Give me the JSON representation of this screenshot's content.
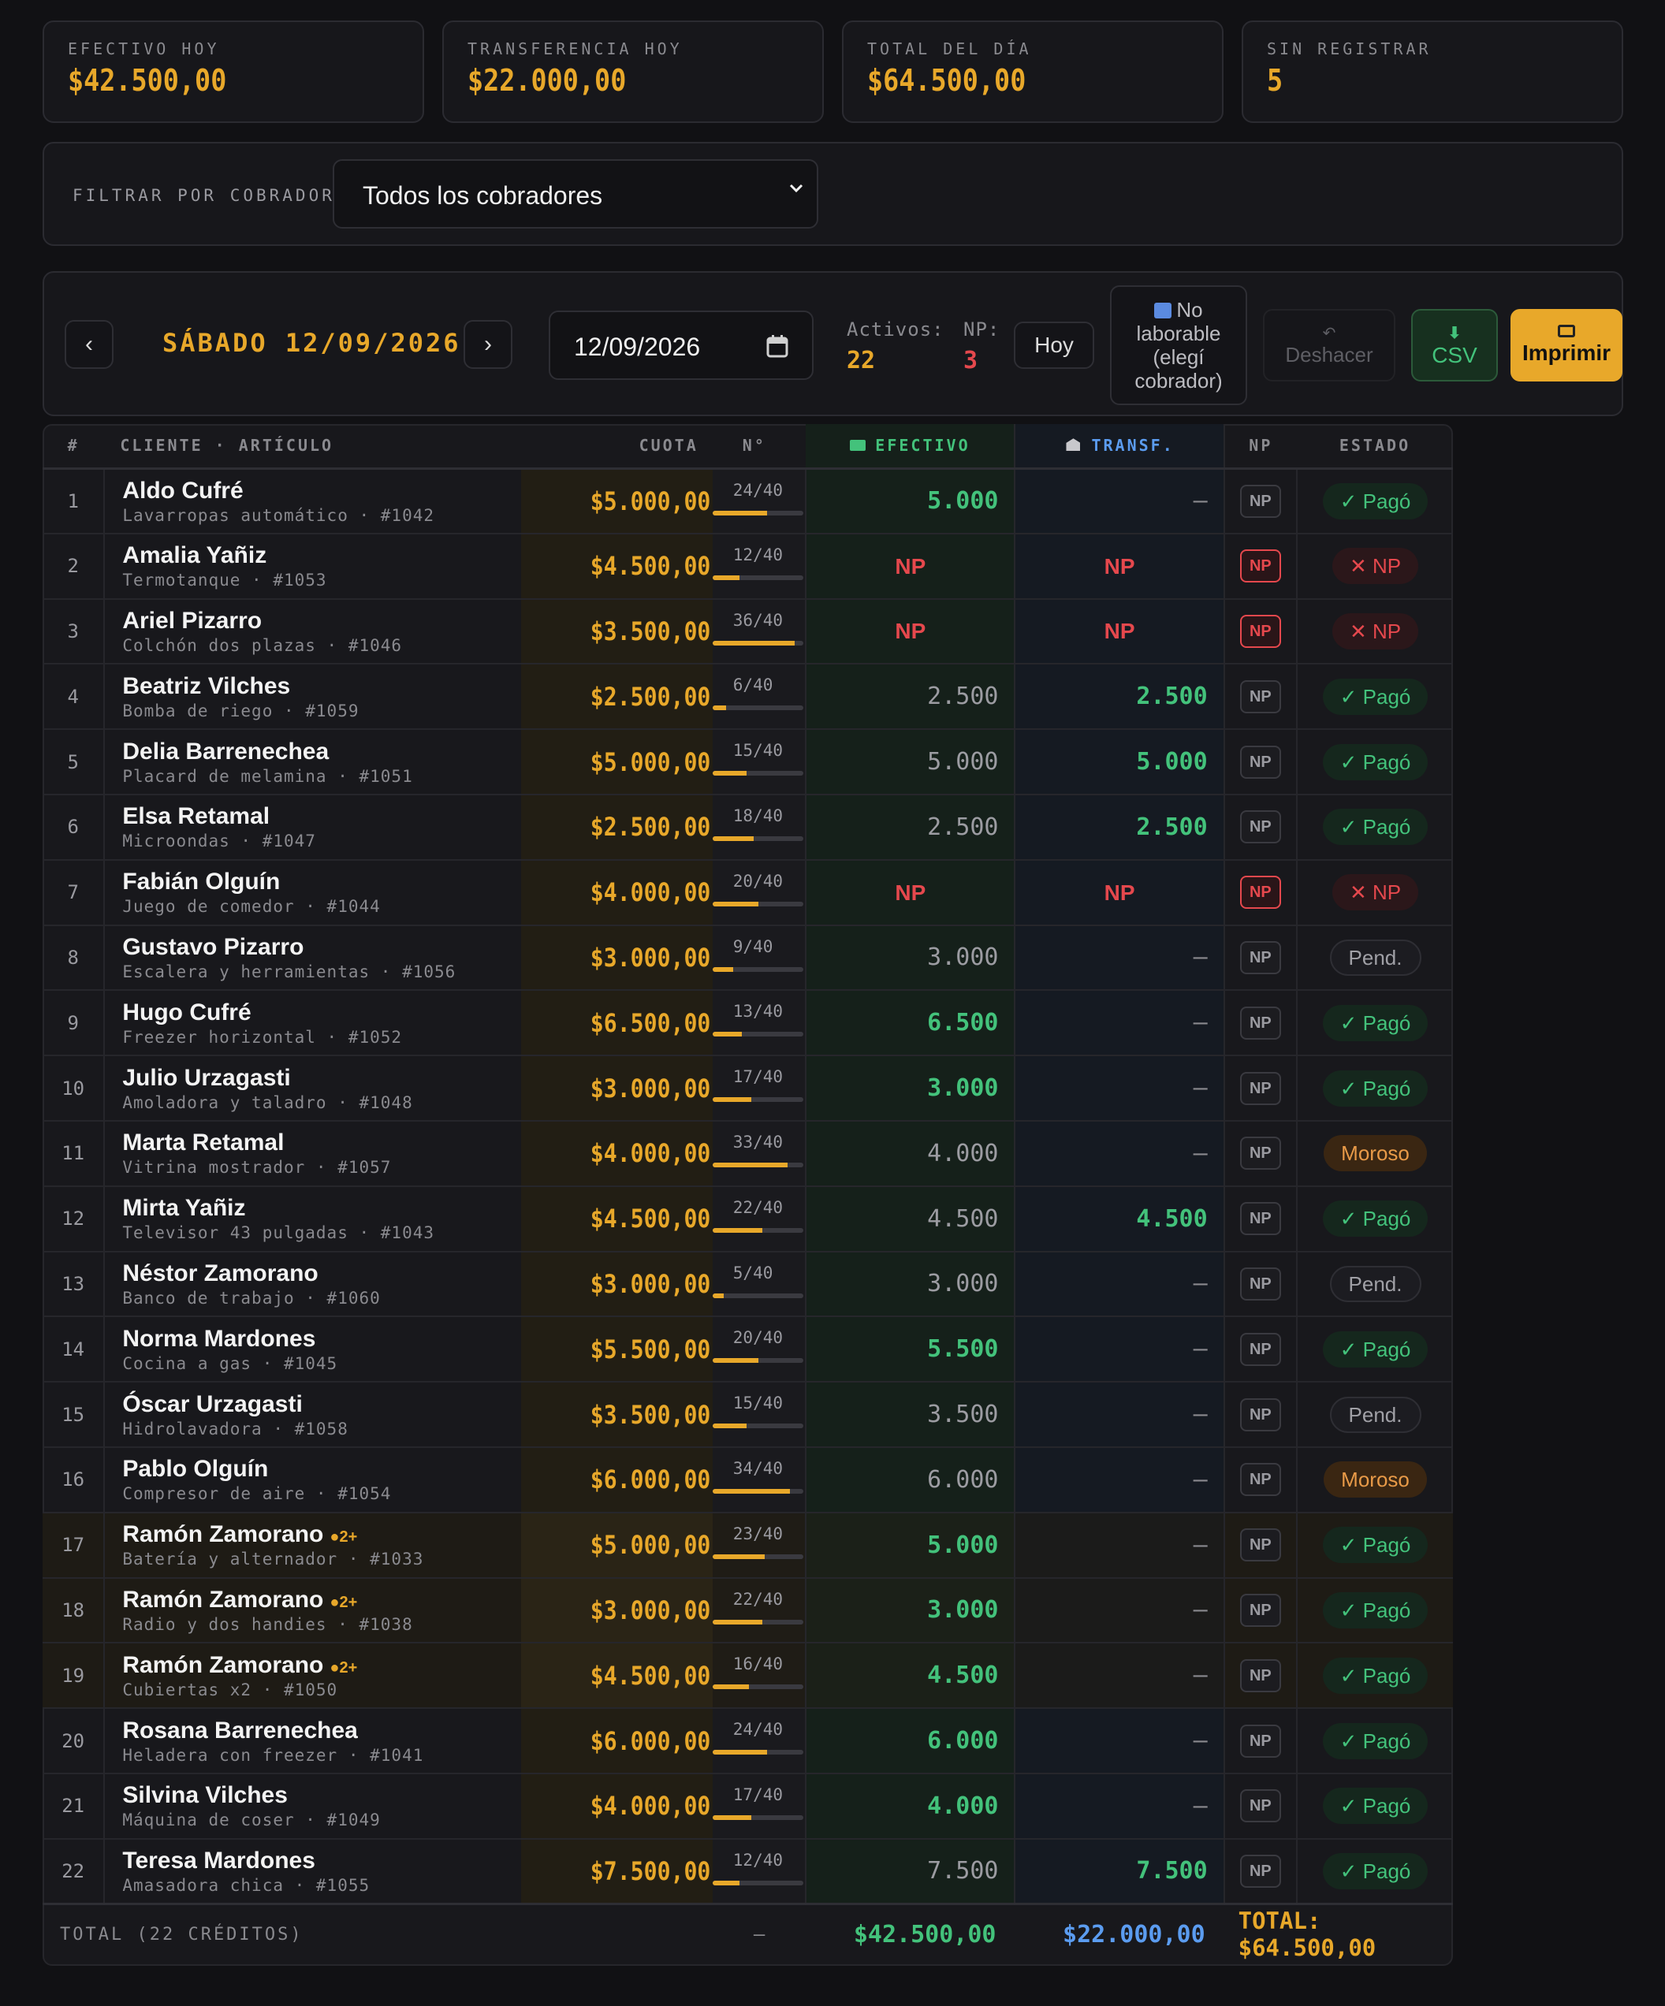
{
  "stats": [
    {
      "label": "EFECTIVO HOY",
      "value": "$42.500,00"
    },
    {
      "label": "TRANSFERENCIA HOY",
      "value": "$22.000,00"
    },
    {
      "label": "TOTAL DEL DÍA",
      "value": "$64.500,00"
    },
    {
      "label": "SIN REGISTRAR",
      "value": "5"
    }
  ],
  "filter": {
    "label": "FILTRAR POR COBRADOR",
    "selected": "Todos los cobradores"
  },
  "toolbar": {
    "prev": "‹",
    "next": "›",
    "day_label": "SÁBADO 12/09/2026",
    "date_value": "12/09/2026",
    "activos_label": "Activos:",
    "activos_value": "22",
    "np_label": "NP:",
    "np_value": "3",
    "hoy_label": "Hoy",
    "nolab_line1": "No",
    "nolab_line2": "laborable",
    "nolab_line3": "(elegí",
    "nolab_line4": "cobrador)",
    "deshacer_label": "Deshacer",
    "csv_label": "CSV",
    "imprimir_label": "Imprimir"
  },
  "table": {
    "headers": {
      "idx": "#",
      "cliente": "CLIENTE · ARTÍCULO",
      "cuota": "CUOTA",
      "n": "N°",
      "efectivo": "EFECTIVO",
      "transf": "TRANSF.",
      "np": "NP",
      "estado": "ESTADO"
    },
    "rows": [
      {
        "i": "1",
        "name": "Aldo Cufré",
        "sub": "Lavarropas automático · #1042",
        "cuota": "$5.000,00",
        "n": "24/40",
        "prog": 0.6,
        "ef": "5.000",
        "efc": "green",
        "tr": "—",
        "trc": "dash",
        "np": false,
        "st": "✓ Pagó",
        "stc": "pago",
        "dup": false
      },
      {
        "i": "2",
        "name": "Amalia Yañiz",
        "sub": "Termotanque · #1053",
        "cuota": "$4.500,00",
        "n": "12/40",
        "prog": 0.3,
        "ef": "NP",
        "efc": "np",
        "tr": "NP",
        "trc": "np",
        "np": true,
        "st": "✕ NP",
        "stc": "np",
        "dup": false
      },
      {
        "i": "3",
        "name": "Ariel Pizarro",
        "sub": "Colchón dos plazas · #1046",
        "cuota": "$3.500,00",
        "n": "36/40",
        "prog": 0.9,
        "ef": "NP",
        "efc": "np",
        "tr": "NP",
        "trc": "np",
        "np": true,
        "st": "✕ NP",
        "stc": "np",
        "dup": false
      },
      {
        "i": "4",
        "name": "Beatriz Vilches",
        "sub": "Bomba de riego · #1059",
        "cuota": "$2.500,00",
        "n": "6/40",
        "prog": 0.15,
        "ef": "2.500",
        "efc": "grey",
        "tr": "2.500",
        "trc": "green",
        "np": false,
        "st": "✓ Pagó",
        "stc": "pago",
        "dup": false
      },
      {
        "i": "5",
        "name": "Delia Barrenechea",
        "sub": "Placard de melamina · #1051",
        "cuota": "$5.000,00",
        "n": "15/40",
        "prog": 0.375,
        "ef": "5.000",
        "efc": "grey",
        "tr": "5.000",
        "trc": "green",
        "np": false,
        "st": "✓ Pagó",
        "stc": "pago",
        "dup": false
      },
      {
        "i": "6",
        "name": "Elsa Retamal",
        "sub": "Microondas · #1047",
        "cuota": "$2.500,00",
        "n": "18/40",
        "prog": 0.45,
        "ef": "2.500",
        "efc": "grey",
        "tr": "2.500",
        "trc": "green",
        "np": false,
        "st": "✓ Pagó",
        "stc": "pago",
        "dup": false
      },
      {
        "i": "7",
        "name": "Fabián Olguín",
        "sub": "Juego de comedor · #1044",
        "cuota": "$4.000,00",
        "n": "20/40",
        "prog": 0.5,
        "ef": "NP",
        "efc": "np",
        "tr": "NP",
        "trc": "np",
        "np": true,
        "st": "✕ NP",
        "stc": "np",
        "dup": false
      },
      {
        "i": "8",
        "name": "Gustavo Pizarro",
        "sub": "Escalera y herramientas · #1056",
        "cuota": "$3.000,00",
        "n": "9/40",
        "prog": 0.225,
        "ef": "3.000",
        "efc": "grey",
        "tr": "—",
        "trc": "dash",
        "np": false,
        "st": "Pend.",
        "stc": "pend",
        "dup": false
      },
      {
        "i": "9",
        "name": "Hugo Cufré",
        "sub": "Freezer horizontal · #1052",
        "cuota": "$6.500,00",
        "n": "13/40",
        "prog": 0.325,
        "ef": "6.500",
        "efc": "green",
        "tr": "—",
        "trc": "dash",
        "np": false,
        "st": "✓ Pagó",
        "stc": "pago",
        "dup": false
      },
      {
        "i": "10",
        "name": "Julio Urzagasti",
        "sub": "Amoladora y taladro · #1048",
        "cuota": "$3.000,00",
        "n": "17/40",
        "prog": 0.425,
        "ef": "3.000",
        "efc": "green",
        "tr": "—",
        "trc": "dash",
        "np": false,
        "st": "✓ Pagó",
        "stc": "pago",
        "dup": false
      },
      {
        "i": "11",
        "name": "Marta Retamal",
        "sub": "Vitrina mostrador · #1057",
        "cuota": "$4.000,00",
        "n": "33/40",
        "prog": 0.825,
        "ef": "4.000",
        "efc": "grey",
        "tr": "—",
        "trc": "dash",
        "np": false,
        "st": "Moroso",
        "stc": "moroso",
        "dup": false
      },
      {
        "i": "12",
        "name": "Mirta Yañiz",
        "sub": "Televisor 43 pulgadas · #1043",
        "cuota": "$4.500,00",
        "n": "22/40",
        "prog": 0.55,
        "ef": "4.500",
        "efc": "grey",
        "tr": "4.500",
        "trc": "green",
        "np": false,
        "st": "✓ Pagó",
        "stc": "pago",
        "dup": false
      },
      {
        "i": "13",
        "name": "Néstor Zamorano",
        "sub": "Banco de trabajo · #1060",
        "cuota": "$3.000,00",
        "n": "5/40",
        "prog": 0.125,
        "ef": "3.000",
        "efc": "grey",
        "tr": "—",
        "trc": "dash",
        "np": false,
        "st": "Pend.",
        "stc": "pend",
        "dup": false
      },
      {
        "i": "14",
        "name": "Norma Mardones",
        "sub": "Cocina a gas · #1045",
        "cuota": "$5.500,00",
        "n": "20/40",
        "prog": 0.5,
        "ef": "5.500",
        "efc": "green",
        "tr": "—",
        "trc": "dash",
        "np": false,
        "st": "✓ Pagó",
        "stc": "pago",
        "dup": false
      },
      {
        "i": "15",
        "name": "Óscar Urzagasti",
        "sub": "Hidrolavadora · #1058",
        "cuota": "$3.500,00",
        "n": "15/40",
        "prog": 0.375,
        "ef": "3.500",
        "efc": "grey",
        "tr": "—",
        "trc": "dash",
        "np": false,
        "st": "Pend.",
        "stc": "pend",
        "dup": false
      },
      {
        "i": "16",
        "name": "Pablo Olguín",
        "sub": "Compresor de aire · #1054",
        "cuota": "$6.000,00",
        "n": "34/40",
        "prog": 0.85,
        "ef": "6.000",
        "efc": "grey",
        "tr": "—",
        "trc": "dash",
        "np": false,
        "st": "Moroso",
        "stc": "moroso",
        "dup": false
      },
      {
        "i": "17",
        "name": "Ramón Zamorano",
        "badge": "●2+",
        "sub": "Batería y alternador · #1033",
        "cuota": "$5.000,00",
        "n": "23/40",
        "prog": 0.575,
        "ef": "5.000",
        "efc": "green",
        "tr": "—",
        "trc": "dash",
        "np": false,
        "st": "✓ Pagó",
        "stc": "pago",
        "dup": true
      },
      {
        "i": "18",
        "name": "Ramón Zamorano",
        "badge": "●2+",
        "sub": "Radio y dos handies · #1038",
        "cuota": "$3.000,00",
        "n": "22/40",
        "prog": 0.55,
        "ef": "3.000",
        "efc": "green",
        "tr": "—",
        "trc": "dash",
        "np": false,
        "st": "✓ Pagó",
        "stc": "pago",
        "dup": true
      },
      {
        "i": "19",
        "name": "Ramón Zamorano",
        "badge": "●2+",
        "sub": "Cubiertas x2 · #1050",
        "cuota": "$4.500,00",
        "n": "16/40",
        "prog": 0.4,
        "ef": "4.500",
        "efc": "green",
        "tr": "—",
        "trc": "dash",
        "np": false,
        "st": "✓ Pagó",
        "stc": "pago",
        "dup": true
      },
      {
        "i": "20",
        "name": "Rosana Barrenechea",
        "sub": "Heladera con freezer · #1041",
        "cuota": "$6.000,00",
        "n": "24/40",
        "prog": 0.6,
        "ef": "6.000",
        "efc": "green",
        "tr": "—",
        "trc": "dash",
        "np": false,
        "st": "✓ Pagó",
        "stc": "pago",
        "dup": false
      },
      {
        "i": "21",
        "name": "Silvina Vilches",
        "sub": "Máquina de coser · #1049",
        "cuota": "$4.000,00",
        "n": "17/40",
        "prog": 0.425,
        "ef": "4.000",
        "efc": "green",
        "tr": "—",
        "trc": "dash",
        "np": false,
        "st": "✓ Pagó",
        "stc": "pago",
        "dup": false
      },
      {
        "i": "22",
        "name": "Teresa Mardones",
        "sub": "Amasadora chica · #1055",
        "cuota": "$7.500,00",
        "n": "12/40",
        "prog": 0.3,
        "ef": "7.500",
        "efc": "grey",
        "tr": "7.500",
        "trc": "green",
        "np": false,
        "st": "✓ Pagó",
        "stc": "pago",
        "dup": false
      }
    ],
    "np_button_label": "NP",
    "footer": {
      "label": "TOTAL (22 CRÉDITOS)",
      "n": "—",
      "efectivo": "$42.500,00",
      "transf": "$22.000,00",
      "total": "TOTAL: $64.500,00"
    }
  },
  "icons": {
    "select": "chevron-down-icon",
    "date": "calendar-icon",
    "efectivo": "cash-icon",
    "transf": "bank-icon",
    "nolab": "calendar-icon",
    "deshacer": "undo-icon",
    "csv": "download-icon",
    "imprimir": "printer-icon"
  },
  "colors": {
    "accent": "#e8a82a",
    "green": "#43c27b",
    "red": "#e5484d",
    "blue": "#5b9cf0",
    "orange": "#e89a48"
  }
}
